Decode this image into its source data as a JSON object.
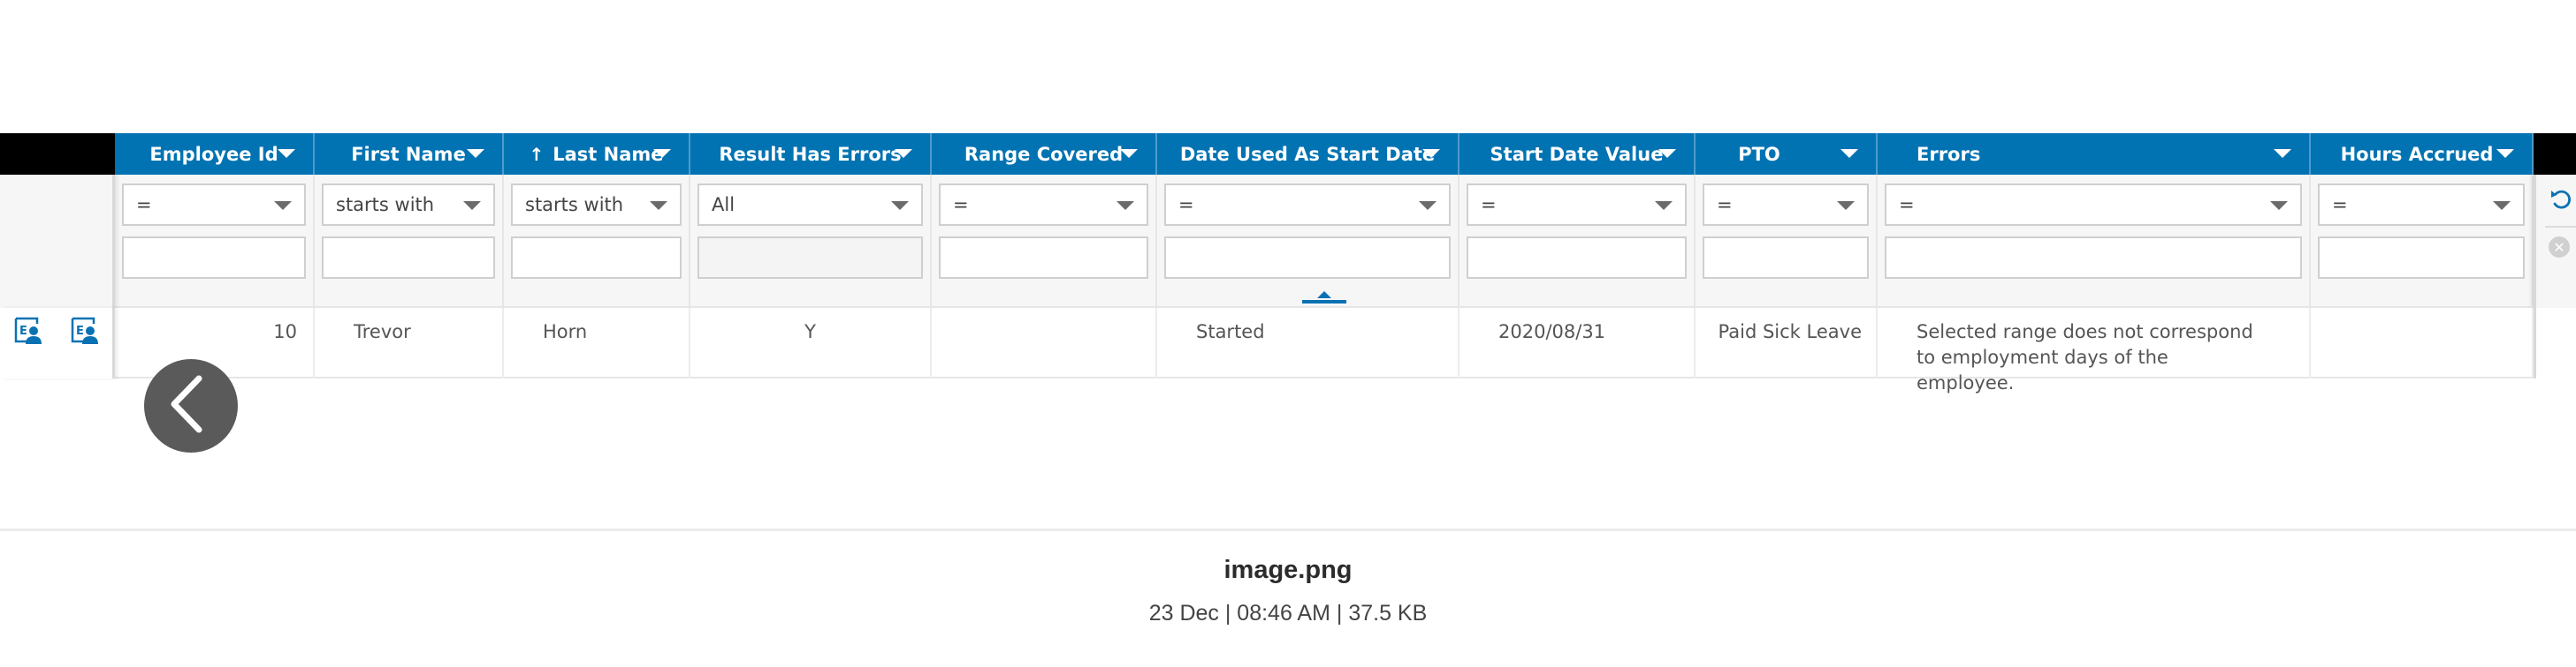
{
  "grid": {
    "columns": [
      {
        "label": "Employee Id",
        "sort": "",
        "filter_op": "=",
        "filter_value": ""
      },
      {
        "label": "First Name",
        "sort": "",
        "filter_op": "starts with",
        "filter_value": ""
      },
      {
        "label": "Last Name",
        "sort": "↑",
        "filter_op": "starts with",
        "filter_value": ""
      },
      {
        "label": "Result Has Errors",
        "sort": "",
        "filter_op": "All",
        "filter_value": ""
      },
      {
        "label": "Range Covered",
        "sort": "",
        "filter_op": "=",
        "filter_value": ""
      },
      {
        "label": "Date Used As Start Date",
        "sort": "",
        "filter_op": "=",
        "filter_value": ""
      },
      {
        "label": "Start Date Value",
        "sort": "",
        "filter_op": "=",
        "filter_value": ""
      },
      {
        "label": "PTO",
        "sort": "",
        "filter_op": "=",
        "filter_value": ""
      },
      {
        "label": "Errors",
        "sort": "",
        "filter_op": "=",
        "filter_value": ""
      },
      {
        "label": "Hours Accrued",
        "sort": "",
        "filter_op": "=",
        "filter_value": ""
      }
    ],
    "rows": [
      {
        "cells": [
          "10",
          "Trevor",
          "Horn",
          "Y",
          "",
          "Started",
          "2020/08/31",
          "Paid Sick Leave",
          "Selected range does not correspond to employment days of the employee.",
          ""
        ]
      }
    ],
    "icons": {
      "row_action_1": "employee-details-icon",
      "row_action_2": "employee-details-icon",
      "reset_filters": "reset-icon",
      "clear_filters": "clear-icon",
      "collapse_filters": "collapse-up-icon"
    },
    "header_color": "#0273b2"
  },
  "viewer": {
    "back_icon": "chevron-left-icon",
    "file_name": "image.png",
    "file_meta": "23 Dec | 08:46 AM | 37.5 KB"
  }
}
